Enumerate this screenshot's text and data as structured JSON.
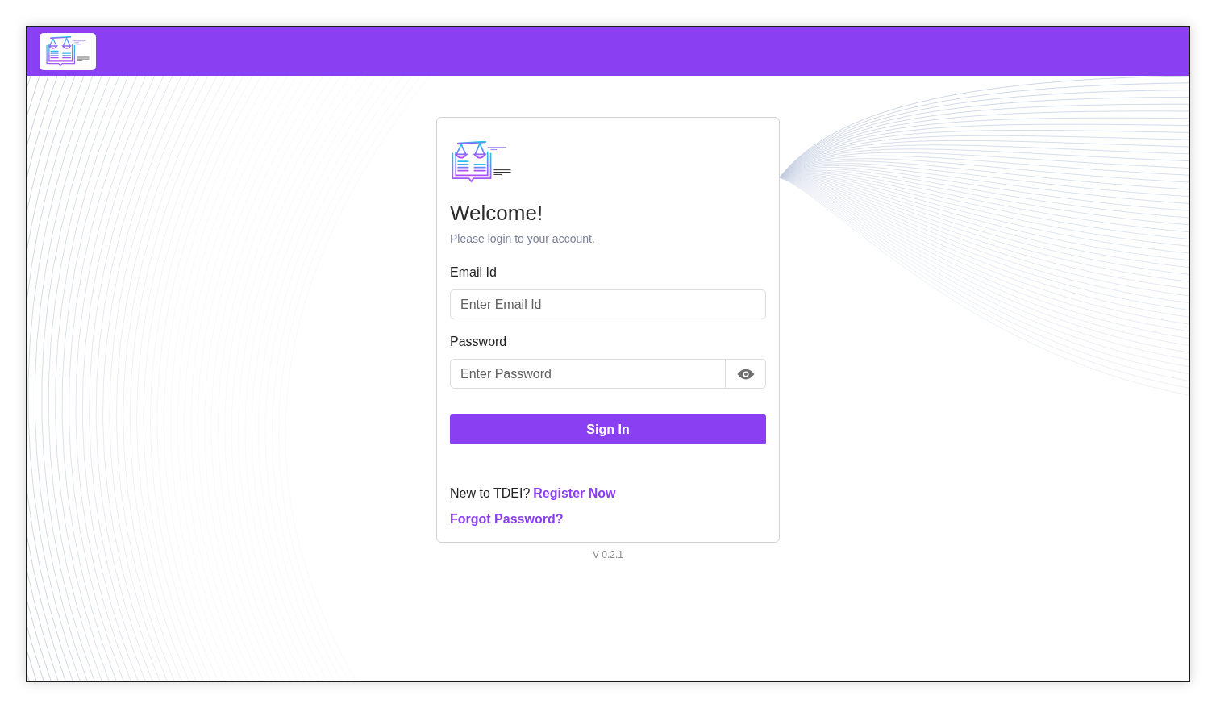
{
  "login_card": {
    "title": "Welcome!",
    "subtitle": "Please login to your account.",
    "fields": [
      {
        "kind": "email",
        "label": "Email Id",
        "placeholder": "Enter Email Id"
      },
      {
        "kind": "password",
        "label": "Password",
        "placeholder": "Enter Password"
      }
    ],
    "submit_button": "Sign In",
    "register_prompt": "New to TDEI?",
    "register_link": "Register Now",
    "forgot_link": "Forgot Password?"
  },
  "version": "V 0.2.1"
}
